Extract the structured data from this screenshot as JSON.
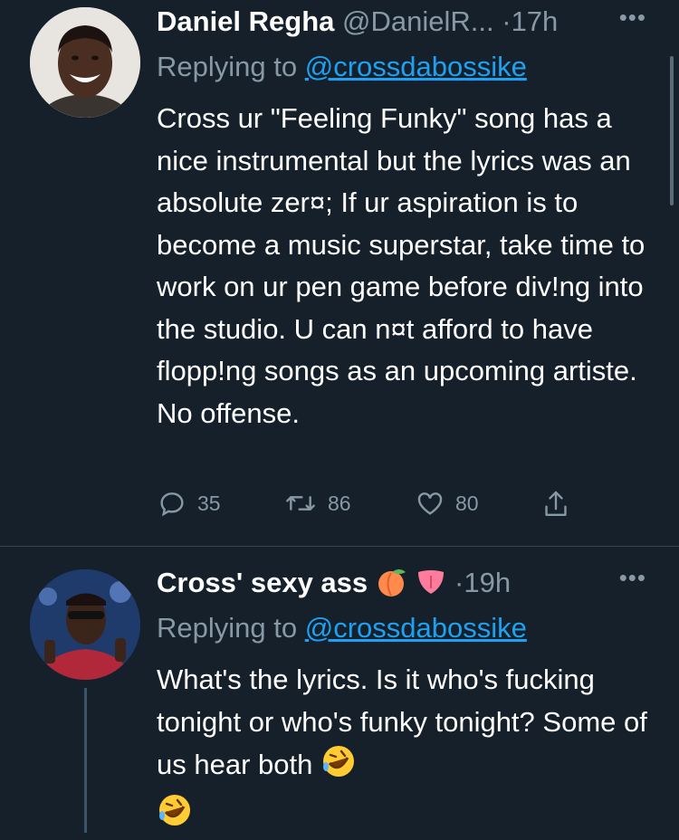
{
  "tweets": [
    {
      "name": "Daniel Regha",
      "handle": "@DanielR...",
      "dot": "·",
      "time": "17h",
      "replying_prefix": "Replying to",
      "replying_to": "@crossdabossike",
      "text": "Cross ur \"Feeling Funky\" song has a nice instrumental but the lyrics was an absolute zer¤; If ur aspiration is to become a  music superstar, take time to work on ur pen game before div!ng into the studio. U can n¤t afford to have flopp!ng songs as an upcoming artiste. No offense.",
      "counts": {
        "replies": "35",
        "retweets": "86",
        "likes": "80"
      },
      "more_icon": "more-horizontal-icon"
    },
    {
      "name": "Cross' sexy ass",
      "name_emojis": [
        "peach-emoji",
        "tongue-emoji"
      ],
      "dot": "·",
      "time": "19h",
      "replying_prefix": "Replying to",
      "replying_to": "@crossdabossike",
      "text": "What's the lyrics. Is it who's fucking tonight or who's funky tonight? Some of us hear both",
      "trailing_emojis": [
        "rofl-emoji",
        "rofl-emoji"
      ],
      "more_icon": "more-horizontal-icon"
    }
  ],
  "colors": {
    "background": "#15202b",
    "text": "#ffffff",
    "secondary": "#8899a6",
    "link": "#1da1f2",
    "divider": "#38444d"
  }
}
